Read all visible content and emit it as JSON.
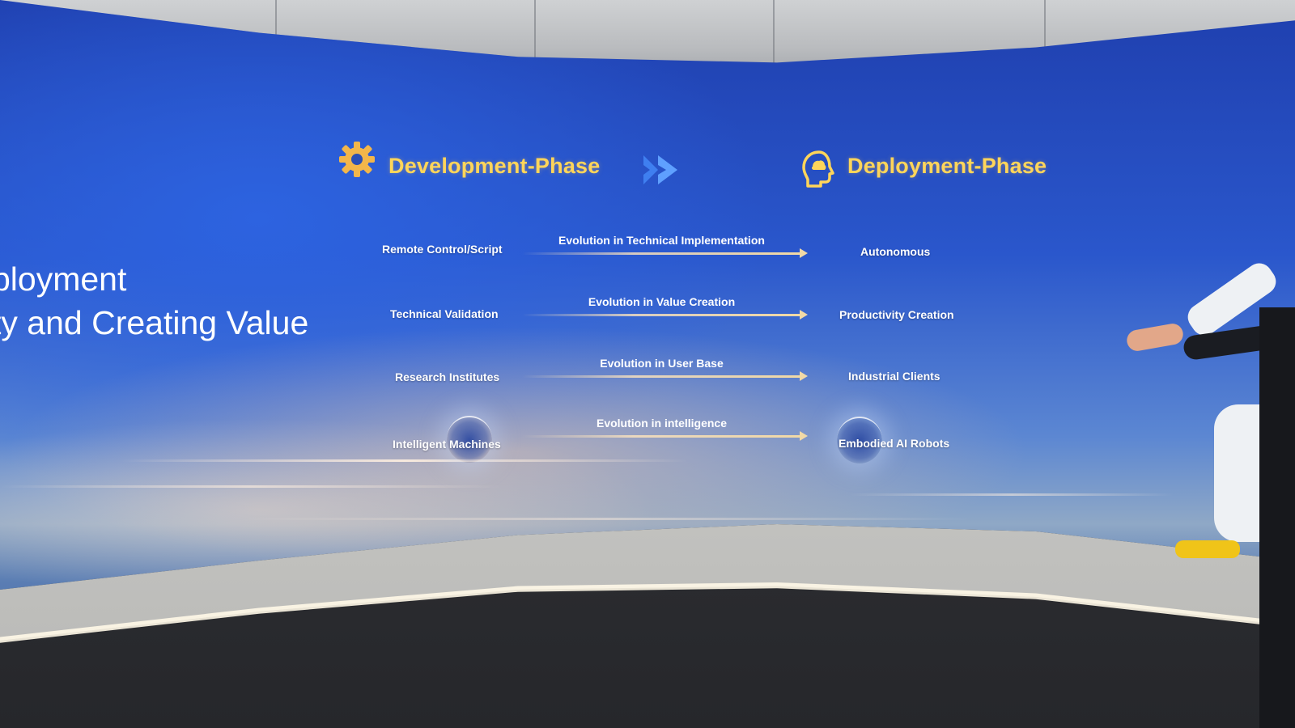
{
  "headline": {
    "line1": "ployment",
    "line2": "ty and Creating Value"
  },
  "phases": {
    "development": {
      "title": "Development-Phase",
      "icon": "gear-icon"
    },
    "arrow_icon": "double-chevron-right-icon",
    "deployment": {
      "title": "Deployment-Phase",
      "icon": "head-icon"
    }
  },
  "rows": [
    {
      "from": "Remote Control/Script",
      "evolution": "Evolution in Technical Implementation",
      "to": "Autonomous"
    },
    {
      "from": "Technical Validation",
      "evolution": "Evolution in Value Creation",
      "to": "Productivity Creation"
    },
    {
      "from": "Research Institutes",
      "evolution": "Evolution in User Base",
      "to": "Industrial Clients"
    },
    {
      "from": "Intelligent Machines",
      "evolution": "Evolution in intelligence",
      "to": "Embodied AI Robots"
    }
  ],
  "colors": {
    "phase_title": "#ffd55a",
    "arrow": "#f1d9a6",
    "chevron": "#3f7ff0"
  }
}
